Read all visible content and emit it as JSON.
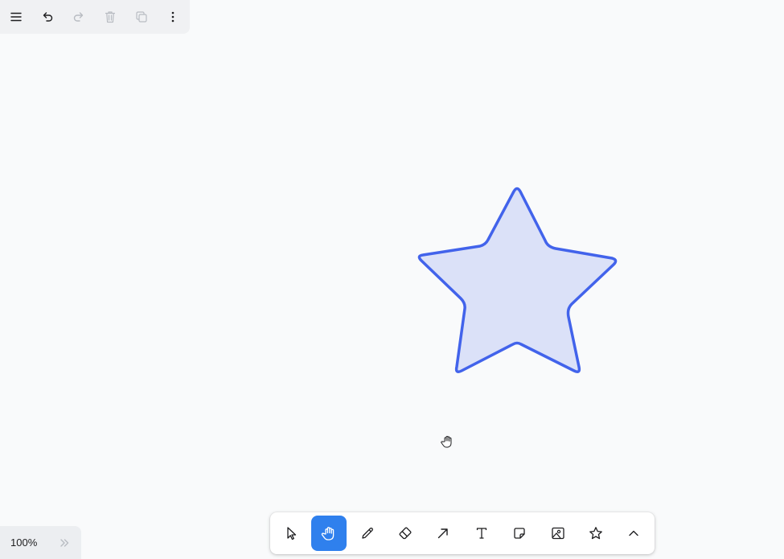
{
  "colors": {
    "canvas_bg": "#f9fafb",
    "accent": "#2f80ed",
    "star_stroke": "#4263eb",
    "star_fill": "#dbe1f8",
    "icon_default": "#1d1d1f",
    "icon_disabled": "#b8bcc2"
  },
  "top_menu": {
    "items": [
      {
        "name": "menu-icon",
        "enabled": true
      },
      {
        "name": "undo-icon",
        "enabled": true
      },
      {
        "name": "redo-icon",
        "enabled": false
      },
      {
        "name": "trash-icon",
        "enabled": false
      },
      {
        "name": "duplicate-icon",
        "enabled": false
      },
      {
        "name": "more-options-icon",
        "enabled": true
      }
    ]
  },
  "zoom": {
    "level": "100%"
  },
  "toolbar": {
    "tools": [
      {
        "name": "select-icon",
        "active": false
      },
      {
        "name": "hand-icon",
        "active": true
      },
      {
        "name": "draw-icon",
        "active": false
      },
      {
        "name": "eraser-icon",
        "active": false
      },
      {
        "name": "arrow-icon",
        "active": false
      },
      {
        "name": "text-icon",
        "active": false
      },
      {
        "name": "note-icon",
        "active": false
      },
      {
        "name": "image-icon",
        "active": false
      },
      {
        "name": "shape-star-icon",
        "active": false
      },
      {
        "name": "chevron-up-icon",
        "active": false
      }
    ]
  },
  "canvas": {
    "shape": "star"
  }
}
